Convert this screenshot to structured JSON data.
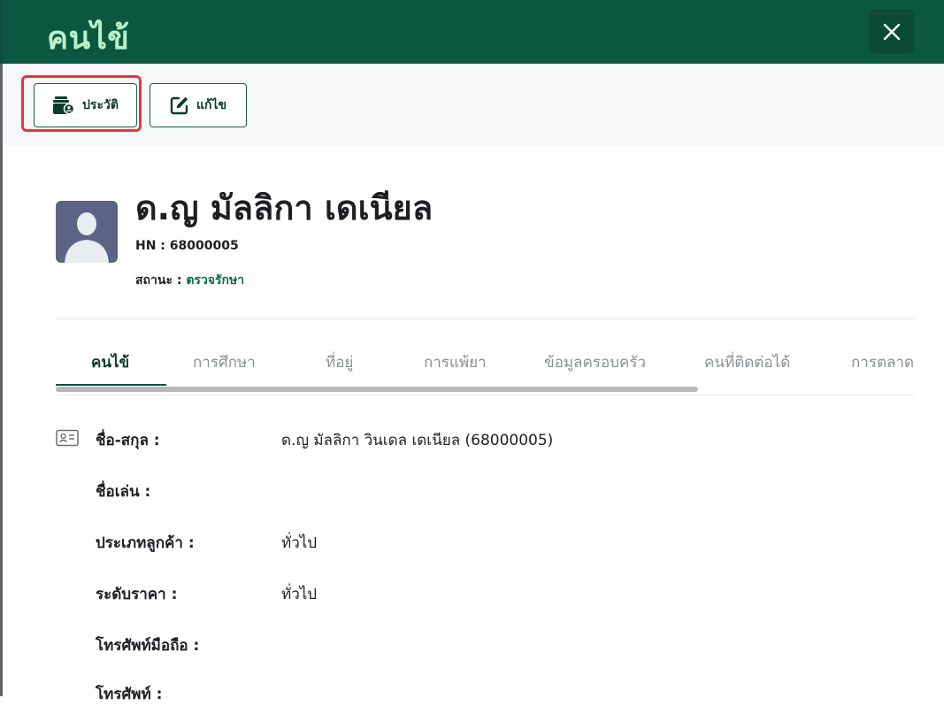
{
  "header": {
    "title": "คนไข้",
    "close_icon": "close-icon"
  },
  "toolbar": {
    "history_label": "ประวัติ",
    "history_icon": "wallet-user-icon",
    "edit_label": "แก้ไข",
    "edit_icon": "edit-icon"
  },
  "profile": {
    "name": "ด.ญ มัลลิกา เดเนียล",
    "hn_label": "HN :",
    "hn_value": "68000005",
    "status_label": "สถานะ :",
    "status_value": "ตรวจรักษา"
  },
  "tabs": [
    {
      "label": "คนไข้",
      "active": true
    },
    {
      "label": "การศึกษา",
      "active": false
    },
    {
      "label": "ที่อยู่",
      "active": false
    },
    {
      "label": "การแพ้ยา",
      "active": false
    },
    {
      "label": "ข้อมูลครอบครัว",
      "active": false
    },
    {
      "label": "คนที่ติดต่อได้",
      "active": false
    },
    {
      "label": "การตลาด",
      "active": false
    }
  ],
  "fields": [
    {
      "label": "ชื่อ-สกุล :",
      "value": "ด.ญ มัลลิกา วินเดล เดเนียล (68000005)"
    },
    {
      "label": "ชื่อเล่น :",
      "value": ""
    },
    {
      "label": "ประเภทลูกค้า :",
      "value": "ทั่วไป"
    },
    {
      "label": "ระดับราคา :",
      "value": "ทั่วไป"
    },
    {
      "label": "โทรศัพท์มือถือ :",
      "value": ""
    },
    {
      "label": "โทรศัพท์ :",
      "value": ""
    }
  ],
  "colors": {
    "header_bg": "#0b5740",
    "header_title": "#b9f0c9",
    "accent": "#0b6b4c",
    "highlight": "#e03a3a"
  }
}
